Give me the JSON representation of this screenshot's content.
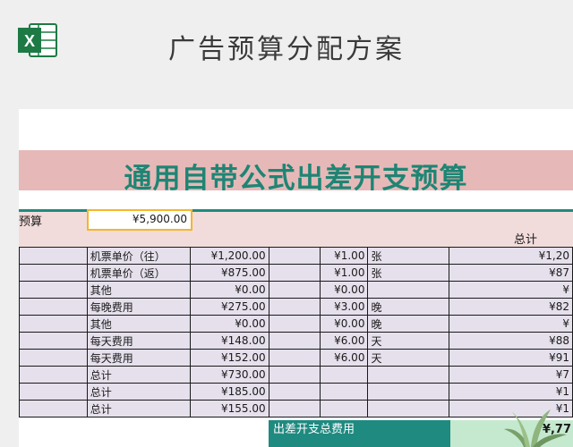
{
  "header": {
    "title": "广告预算分配方案",
    "icon": "excel-icon"
  },
  "sheet": {
    "banner_title": "通用自带公式出差开支预算",
    "budget_label": "预算",
    "budget_value": "¥5,900.00",
    "total_header": "总计",
    "rows": [
      {
        "item": "机票单价（往）",
        "amount": "¥1,200.00",
        "qty": "¥1.00",
        "unit": "张",
        "total": "¥1,20"
      },
      {
        "item": "机票单价（返）",
        "amount": "¥875.00",
        "qty": "¥1.00",
        "unit": "张",
        "total": "¥87"
      },
      {
        "item": "其他",
        "amount": "¥0.00",
        "qty": "¥0.00",
        "unit": "",
        "total": "¥"
      },
      {
        "item": "每晚费用",
        "amount": "¥275.00",
        "qty": "¥3.00",
        "unit": "晚",
        "total": "¥82"
      },
      {
        "item": "其他",
        "amount": "¥0.00",
        "qty": "¥0.00",
        "unit": "晚",
        "total": "¥"
      },
      {
        "item": "每天费用",
        "amount": "¥148.00",
        "qty": "¥6.00",
        "unit": "天",
        "total": "¥88"
      },
      {
        "item": "每天费用",
        "amount": "¥152.00",
        "qty": "¥6.00",
        "unit": "天",
        "total": "¥91"
      },
      {
        "item": "总计",
        "amount": "¥730.00",
        "qty": "",
        "unit": "",
        "total": "¥7"
      },
      {
        "item": "总计",
        "amount": "¥185.00",
        "qty": "",
        "unit": "",
        "total": "¥1"
      },
      {
        "item": "总计",
        "amount": "¥155.00",
        "qty": "",
        "unit": "",
        "total": "¥1"
      }
    ],
    "footer_label": "出差开支总费用",
    "footer_value": "¥,77"
  },
  "colors": {
    "banner_bg": "#e6b9b8",
    "banner_text": "#1e8574",
    "accent_teal": "#1f8a80",
    "cell_bg": "#e5e0ec",
    "budget_highlight": "#f5b62b"
  }
}
